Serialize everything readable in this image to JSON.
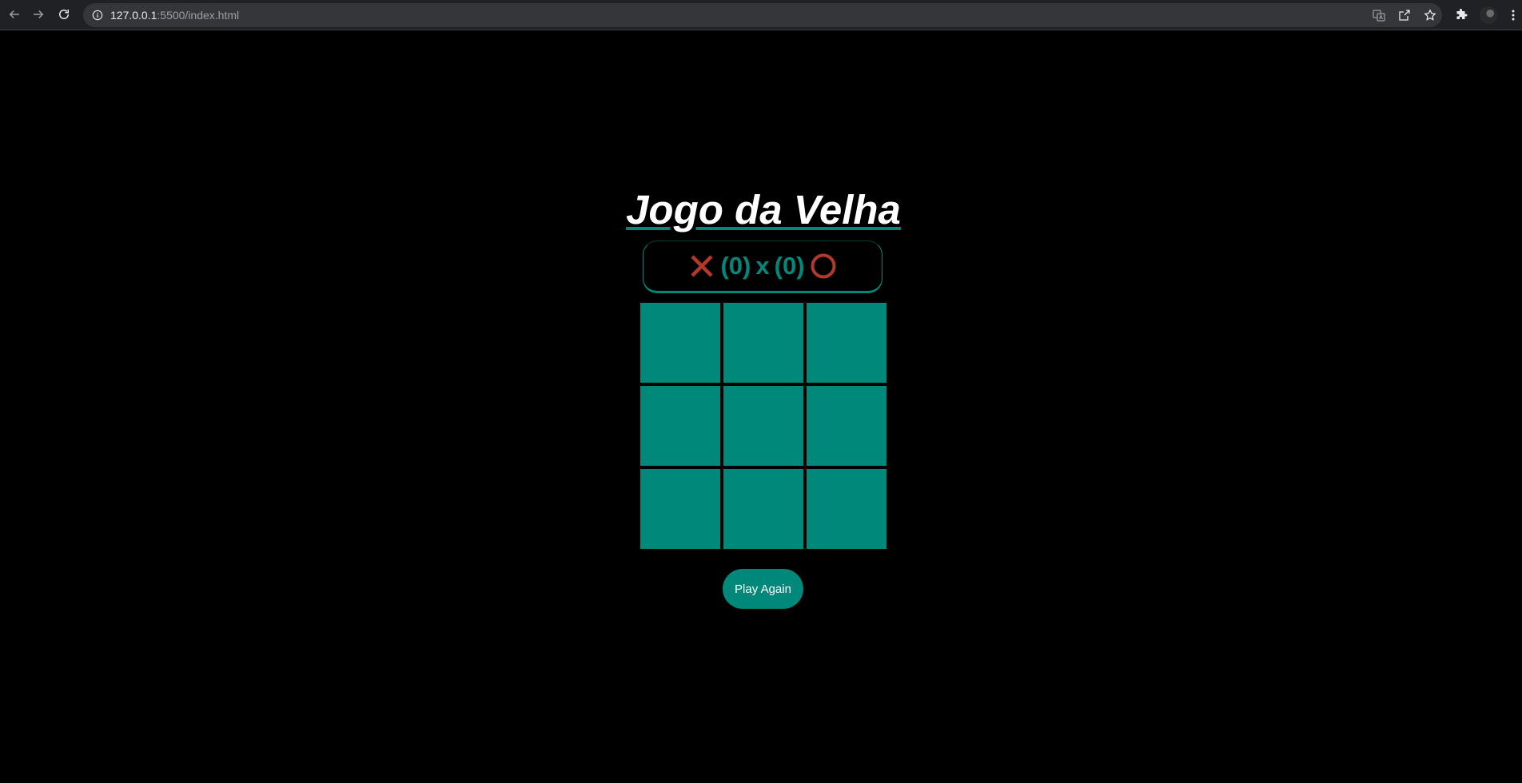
{
  "browser": {
    "url_host": "127.0.0.1",
    "url_rest": ":5500/index.html"
  },
  "game": {
    "title": "Jogo da Velha",
    "score": {
      "x_text": "(0)",
      "separator": "x",
      "o_text": "(0)"
    },
    "board": [
      "",
      "",
      "",
      "",
      "",
      "",
      "",
      "",
      ""
    ],
    "play_again_label": "Play Again"
  },
  "colors": {
    "background": "#000000",
    "accent": "#00897b",
    "mark_color": "#b33a2a",
    "text": "#ffffff"
  },
  "icons": {
    "x_player": "x-mark-icon",
    "o_player": "o-mark-icon"
  }
}
